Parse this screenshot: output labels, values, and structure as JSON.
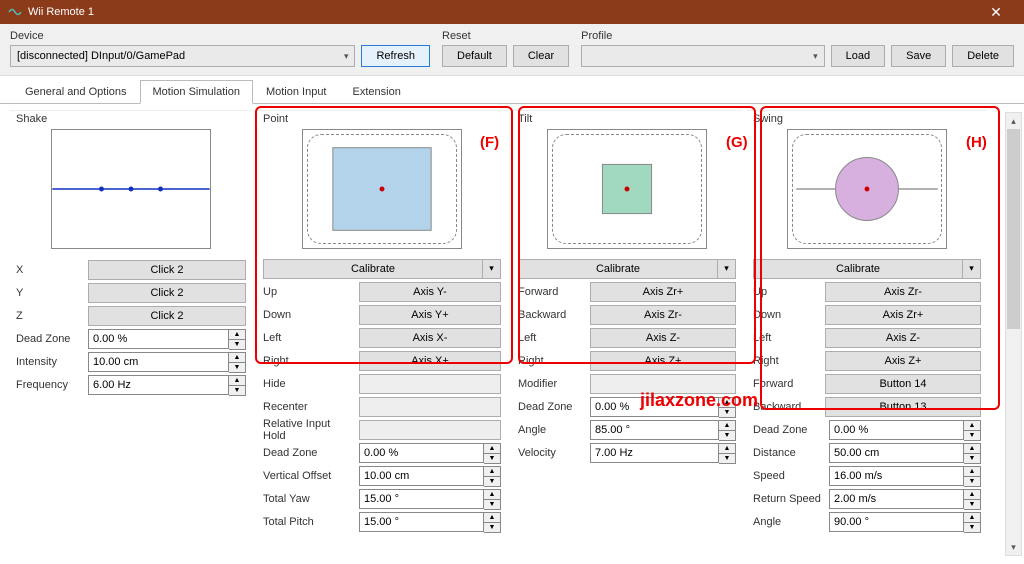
{
  "window": {
    "title": "Wii Remote 1"
  },
  "toolbar": {
    "device_label": "Device",
    "device_value": "[disconnected] DInput/0/GamePad",
    "refresh": "Refresh",
    "reset_label": "Reset",
    "default": "Default",
    "clear": "Clear",
    "profile_label": "Profile",
    "load": "Load",
    "save": "Save",
    "delete": "Delete"
  },
  "tabs": [
    "General and Options",
    "Motion Simulation",
    "Motion Input",
    "Extension"
  ],
  "active_tab": 1,
  "shake": {
    "title": "Shake",
    "rows": [
      {
        "label": "X",
        "value": "Click 2"
      },
      {
        "label": "Y",
        "value": "Click 2"
      },
      {
        "label": "Z",
        "value": "Click 2"
      }
    ],
    "spins": [
      {
        "label": "Dead Zone",
        "value": "0.00 %"
      },
      {
        "label": "Intensity",
        "value": "10.00 cm"
      },
      {
        "label": "Frequency",
        "value": "6.00 Hz"
      }
    ]
  },
  "point": {
    "title": "Point",
    "calibrate": "Calibrate",
    "rows": [
      {
        "label": "Up",
        "value": "Axis Y-"
      },
      {
        "label": "Down",
        "value": "Axis Y+"
      },
      {
        "label": "Left",
        "value": "Axis X-"
      },
      {
        "label": "Right",
        "value": "Axis X+"
      },
      {
        "label": "Hide",
        "value": ""
      },
      {
        "label": "Recenter",
        "value": ""
      },
      {
        "label": "Relative Input Hold",
        "value": ""
      }
    ],
    "spins": [
      {
        "label": "Dead Zone",
        "value": "0.00 %"
      },
      {
        "label": "Vertical Offset",
        "value": "10.00 cm"
      },
      {
        "label": "Total Yaw",
        "value": "15.00 °"
      },
      {
        "label": "Total Pitch",
        "value": "15.00 °"
      }
    ]
  },
  "tilt": {
    "title": "Tilt",
    "calibrate": "Calibrate",
    "rows": [
      {
        "label": "Forward",
        "value": "Axis Zr+"
      },
      {
        "label": "Backward",
        "value": "Axis Zr-"
      },
      {
        "label": "Left",
        "value": "Axis Z-"
      },
      {
        "label": "Right",
        "value": "Axis Z+"
      },
      {
        "label": "Modifier",
        "value": ""
      }
    ],
    "spins": [
      {
        "label": "Dead Zone",
        "value": "0.00 %"
      },
      {
        "label": "Angle",
        "value": "85.00 °"
      },
      {
        "label": "Velocity",
        "value": "7.00 Hz"
      }
    ]
  },
  "swing": {
    "title": "Swing",
    "calibrate": "Calibrate",
    "rows": [
      {
        "label": "Up",
        "value": "Axis Zr-"
      },
      {
        "label": "Down",
        "value": "Axis Zr+"
      },
      {
        "label": "Left",
        "value": "Axis Z-"
      },
      {
        "label": "Right",
        "value": "Axis Z+"
      },
      {
        "label": "Forward",
        "value": "Button 14"
      },
      {
        "label": "Backward",
        "value": "Button 13"
      }
    ],
    "spins": [
      {
        "label": "Dead Zone",
        "value": "0.00 %"
      },
      {
        "label": "Distance",
        "value": "50.00 cm"
      },
      {
        "label": "Speed",
        "value": "16.00 m/s"
      },
      {
        "label": "Return Speed",
        "value": "2.00 m/s"
      },
      {
        "label": "Angle",
        "value": "90.00 °"
      }
    ]
  },
  "annotations": {
    "f": "(F)",
    "g": "(G)",
    "h": "(H)",
    "watermark": "jilaxzone.com"
  }
}
